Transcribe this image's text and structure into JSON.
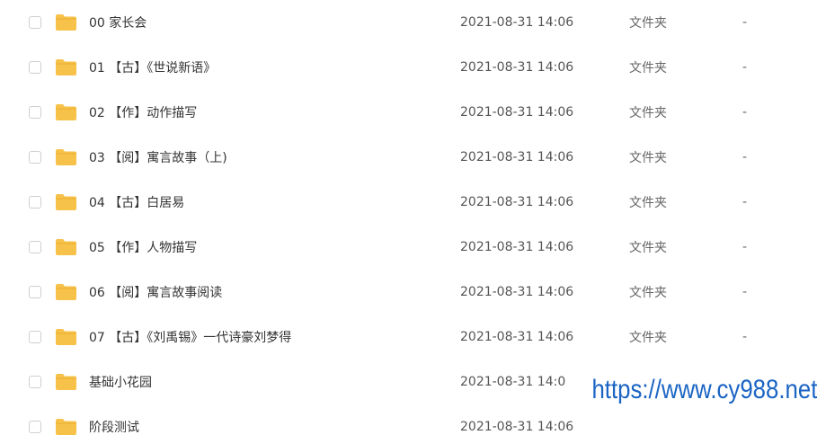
{
  "files": [
    {
      "name": "00 家长会",
      "modified": "2021-08-31 14:06",
      "type": "文件夹",
      "size": "-"
    },
    {
      "name": "01 【古】《世说新语》",
      "modified": "2021-08-31 14:06",
      "type": "文件夹",
      "size": "-"
    },
    {
      "name": "02 【作】动作描写",
      "modified": "2021-08-31 14:06",
      "type": "文件夹",
      "size": "-"
    },
    {
      "name": "03 【阅】寓言故事（上)",
      "modified": "2021-08-31 14:06",
      "type": "文件夹",
      "size": "-"
    },
    {
      "name": "04 【古】白居易",
      "modified": "2021-08-31 14:06",
      "type": "文件夹",
      "size": "-"
    },
    {
      "name": "05 【作】人物描写",
      "modified": "2021-08-31 14:06",
      "type": "文件夹",
      "size": "-"
    },
    {
      "name": "06 【阅】寓言故事阅读",
      "modified": "2021-08-31 14:06",
      "type": "文件夹",
      "size": "-"
    },
    {
      "name": "07 【古】《刘禹锡》一代诗豪刘梦得",
      "modified": "2021-08-31 14:06",
      "type": "文件夹",
      "size": "-"
    },
    {
      "name": "基础小花园",
      "modified": "2021-08-31 14:0",
      "type": "",
      "size": ""
    },
    {
      "name": "阶段测试",
      "modified": "2021-08-31 14:06",
      "type": "",
      "size": ""
    }
  ],
  "watermark": "https://www.cy988.net",
  "colors": {
    "folder": "#f7c24a",
    "folder_tab": "#e9ad2d",
    "watermark": "#1a64c4"
  }
}
